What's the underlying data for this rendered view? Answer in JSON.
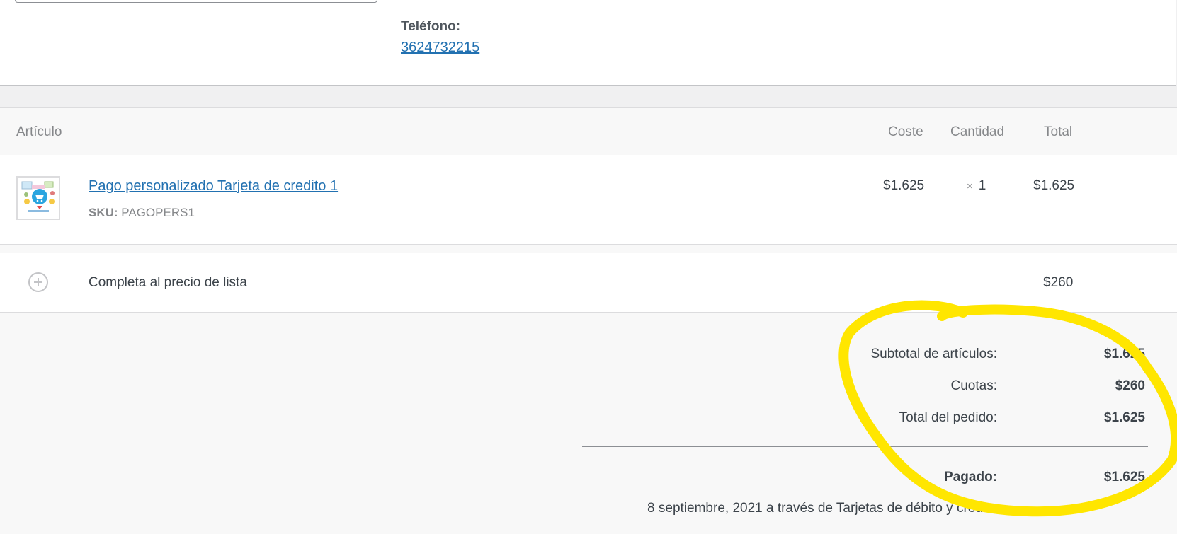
{
  "customer": {
    "phone_label": "Teléfono:",
    "phone_value": "3624732215"
  },
  "items_table": {
    "headers": {
      "article": "Artículo",
      "cost": "Coste",
      "quantity": "Cantidad",
      "total": "Total"
    },
    "items": [
      {
        "name": "Pago personalizado Tarjeta de credito 1",
        "sku_label": "SKU:",
        "sku_value": "PAGOPERS1",
        "cost": "$1.625",
        "qty_symbol": "×",
        "qty": "1",
        "total": "$1.625"
      }
    ],
    "fees": [
      {
        "name": "Completa al precio de lista",
        "total": "$260"
      }
    ]
  },
  "totals": {
    "subtotal_label": "Subtotal de artículos:",
    "subtotal_value": "$1.625",
    "fees_label": "Cuotas:",
    "fees_value": "$260",
    "order_total_label": "Total del pedido:",
    "order_total_value": "$1.625",
    "paid_label": "Pagado:",
    "paid_value": "$1.625",
    "paid_note": "8 septiembre, 2021 a través de Tarjetas de débito y crédito"
  },
  "colors": {
    "link": "#2271b1",
    "highlight": "#ffe600"
  }
}
